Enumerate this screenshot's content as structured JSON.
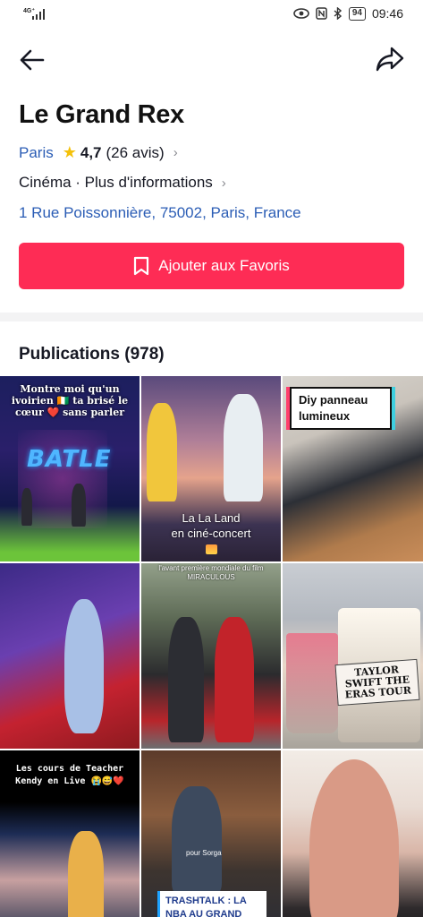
{
  "status_bar": {
    "network": "4G⁺",
    "signal_bars": 4,
    "battery": "94",
    "time": "09:46",
    "icons": [
      "eye-icon",
      "nfc-icon",
      "bluetooth-icon"
    ]
  },
  "nav": {
    "back_icon": "arrow-left-icon",
    "share_icon": "share-arrow-icon"
  },
  "place": {
    "name": "Le Grand Rex",
    "city": "Paris",
    "rating": "4,7",
    "reviews": "(26 avis)",
    "category_info": "Cinéma · Plus d'informations",
    "address": "1 Rue Poissonnière, 75002, Paris, France"
  },
  "favorite_button": {
    "label": "Ajouter aux Favoris",
    "icon": "bookmark-icon"
  },
  "publications": {
    "title": "Publications (978)",
    "tiles": [
      {
        "caption": "Montre moi qu'un ivoirien 🇨🇮 ta brisé le cœur ❤️ sans parler",
        "overlay": "BATLE"
      },
      {
        "caption_line1": "La La Land",
        "caption_line2": "en ciné-concert"
      },
      {
        "caption": "Diy panneau lumineux"
      },
      {
        "caption": ""
      },
      {
        "caption": "l'avant première mondiale du film MIRACULOUS"
      },
      {
        "caption": "TAYLOR SWIFT THE ERAS TOUR"
      },
      {
        "caption": "Les cours de Teacher Kendy en Live 😭😅❤️"
      },
      {
        "caption_small": "pour Sorga",
        "caption": "TRASHTALK : LA NBA AU GRAND REX"
      },
      {
        "caption": ""
      }
    ]
  },
  "colors": {
    "accent": "#fe2c55",
    "link": "#2b5db5",
    "star": "#f4c10a"
  }
}
